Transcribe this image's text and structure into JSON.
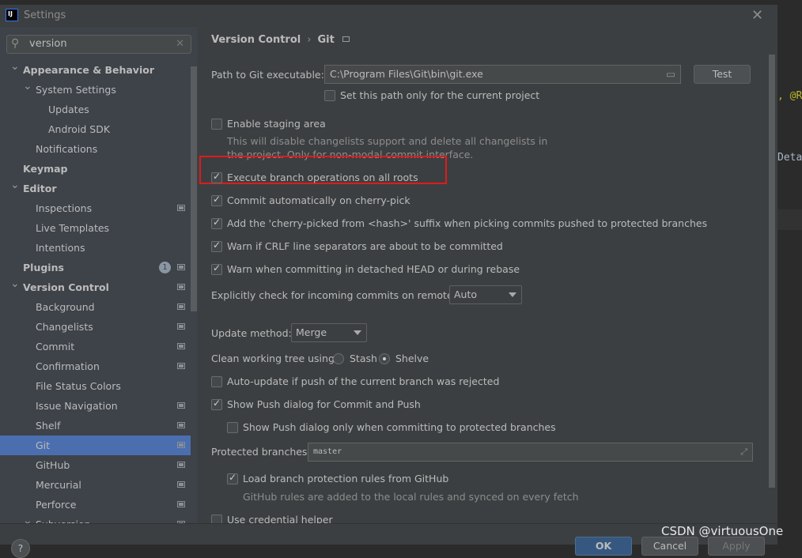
{
  "window": {
    "title": "Settings",
    "logo": "IJ"
  },
  "search": {
    "value": "version"
  },
  "sidebar": {
    "items": [
      {
        "label": "Appearance & Behavior",
        "level": 0,
        "bold": true,
        "expanded": true
      },
      {
        "label": "System Settings",
        "level": 1,
        "expanded": true
      },
      {
        "label": "Updates",
        "level": 2
      },
      {
        "label": "Android SDK",
        "level": 2
      },
      {
        "label": "Notifications",
        "level": 1
      },
      {
        "label": "Keymap",
        "level": 0,
        "bold": true
      },
      {
        "label": "Editor",
        "level": 0,
        "bold": true,
        "expanded": true
      },
      {
        "label": "Inspections",
        "level": 1,
        "pin": true
      },
      {
        "label": "Live Templates",
        "level": 1
      },
      {
        "label": "Intentions",
        "level": 1
      },
      {
        "label": "Plugins",
        "level": 0,
        "bold": true,
        "pin": true,
        "badge": "1"
      },
      {
        "label": "Version Control",
        "level": 0,
        "bold": true,
        "expanded": true,
        "pin": true
      },
      {
        "label": "Background",
        "level": 1,
        "pin": true
      },
      {
        "label": "Changelists",
        "level": 1,
        "pin": true
      },
      {
        "label": "Commit",
        "level": 1,
        "pin": true
      },
      {
        "label": "Confirmation",
        "level": 1,
        "pin": true
      },
      {
        "label": "File Status Colors",
        "level": 1
      },
      {
        "label": "Issue Navigation",
        "level": 1,
        "pin": true
      },
      {
        "label": "Shelf",
        "level": 1,
        "pin": true
      },
      {
        "label": "Git",
        "level": 1,
        "pin": true,
        "selected": true
      },
      {
        "label": "GitHub",
        "level": 1,
        "pin": true
      },
      {
        "label": "Mercurial",
        "level": 1,
        "pin": true
      },
      {
        "label": "Perforce",
        "level": 1,
        "pin": true
      },
      {
        "label": "Subversion",
        "level": 1,
        "pin": true,
        "expanded": true
      }
    ]
  },
  "breadcrumb": {
    "parent": "Version Control",
    "current": "Git"
  },
  "git": {
    "path_label": "Path to Git executable:",
    "path_value": "C:\\Program Files\\Git\\bin\\git.exe",
    "test_label": "Test",
    "set_path_project": {
      "label": "Set this path only for the current project",
      "checked": false
    },
    "staging": {
      "label": "Enable staging area",
      "checked": false,
      "hint1": "This will disable changelists support and delete all changelists in",
      "hint2": "the project. Only for non-modal commit interface."
    },
    "exec_all_roots": {
      "label": "Execute branch operations on all roots",
      "checked": true
    },
    "commit_cherry": {
      "label": "Commit automatically on cherry-pick",
      "checked": true
    },
    "cherry_suffix": {
      "label": "Add the 'cherry-picked from <hash>' suffix when picking commits pushed to protected branches",
      "checked": true
    },
    "warn_crlf": {
      "label": "Warn if CRLF line separators are about to be committed",
      "checked": true
    },
    "warn_detached": {
      "label": "Warn when committing in detached HEAD or during rebase",
      "checked": true
    },
    "incoming_label": "Explicitly check for incoming commits on remotes:",
    "incoming_value": "Auto",
    "update_label": "Update method:",
    "update_value": "Merge",
    "clean_label": "Clean working tree using:",
    "clean_options": [
      "Stash",
      "Shelve"
    ],
    "clean_selected": "Shelve",
    "auto_update": {
      "label": "Auto-update if push of the current branch was rejected",
      "checked": false
    },
    "show_push": {
      "label": "Show Push dialog for Commit and Push",
      "checked": true
    },
    "show_push_protected": {
      "label": "Show Push dialog only when committing to protected branches",
      "checked": false
    },
    "protected_label": "Protected branches:",
    "protected_value": "master",
    "load_rules": {
      "label": "Load branch protection rules from GitHub",
      "checked": true,
      "hint": "GitHub rules are added to the local rules and synced on every fetch"
    },
    "credential": {
      "label": "Use credential helper",
      "checked": false
    }
  },
  "footer": {
    "help": "?",
    "ok": "OK",
    "cancel": "Cancel",
    "apply": "Apply"
  },
  "watermark": "CSDN @virtuousOne",
  "editor_bg": {
    "line1": ", @R",
    "line2": "Deta"
  },
  "colors": {
    "selected": "#4b6eaf",
    "highlight_box": "#e01b1b",
    "ok_button": "#365880"
  }
}
